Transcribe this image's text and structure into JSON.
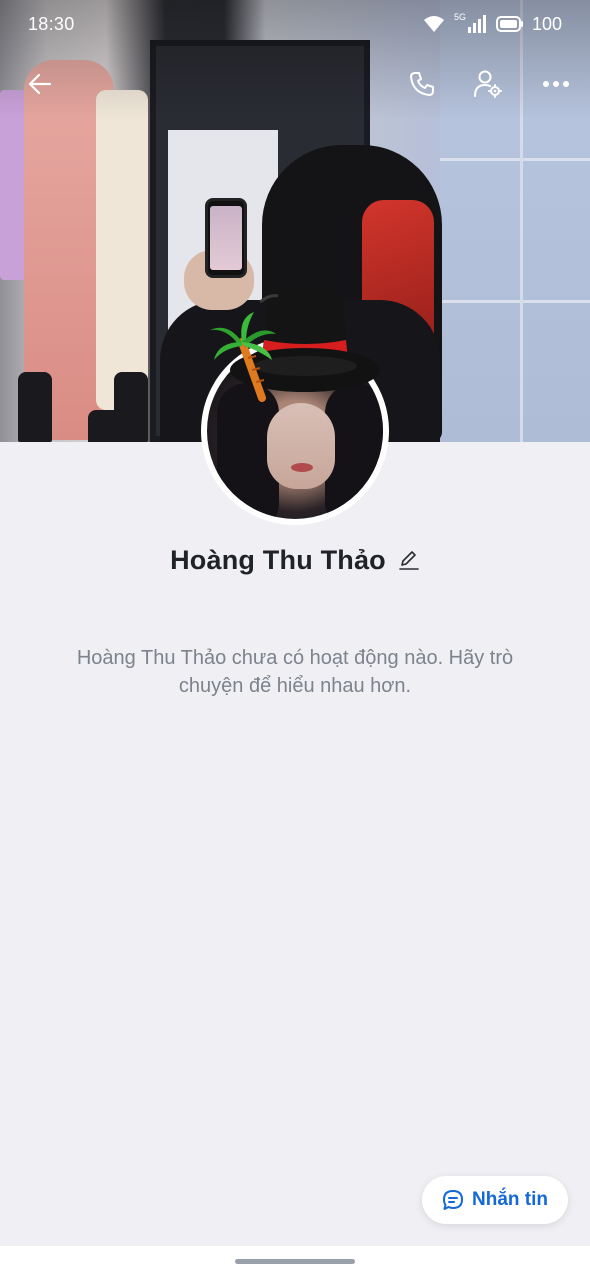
{
  "status_bar": {
    "time": "18:30",
    "network": "5G",
    "battery": "100"
  },
  "top_bar": {
    "back_icon": "arrow-left-icon",
    "call_icon": "phone-icon",
    "settings_icon": "user-settings-icon",
    "more_icon": "more-horizontal-icon"
  },
  "profile": {
    "name": "Hoàng Thu Thảo",
    "edit_icon": "pencil-icon"
  },
  "empty_state": {
    "message": "Hoàng Thu Thảo chưa có hoạt động nào. Hãy trò chuyện để hiểu nhau hơn."
  },
  "actions": {
    "message_label": "Nhắn tin",
    "message_icon": "chat-bubble-icon"
  },
  "colors": {
    "background": "#efeff4",
    "accent": "#1468d8",
    "name_text": "#1f2226",
    "muted_text": "#7d838c"
  }
}
